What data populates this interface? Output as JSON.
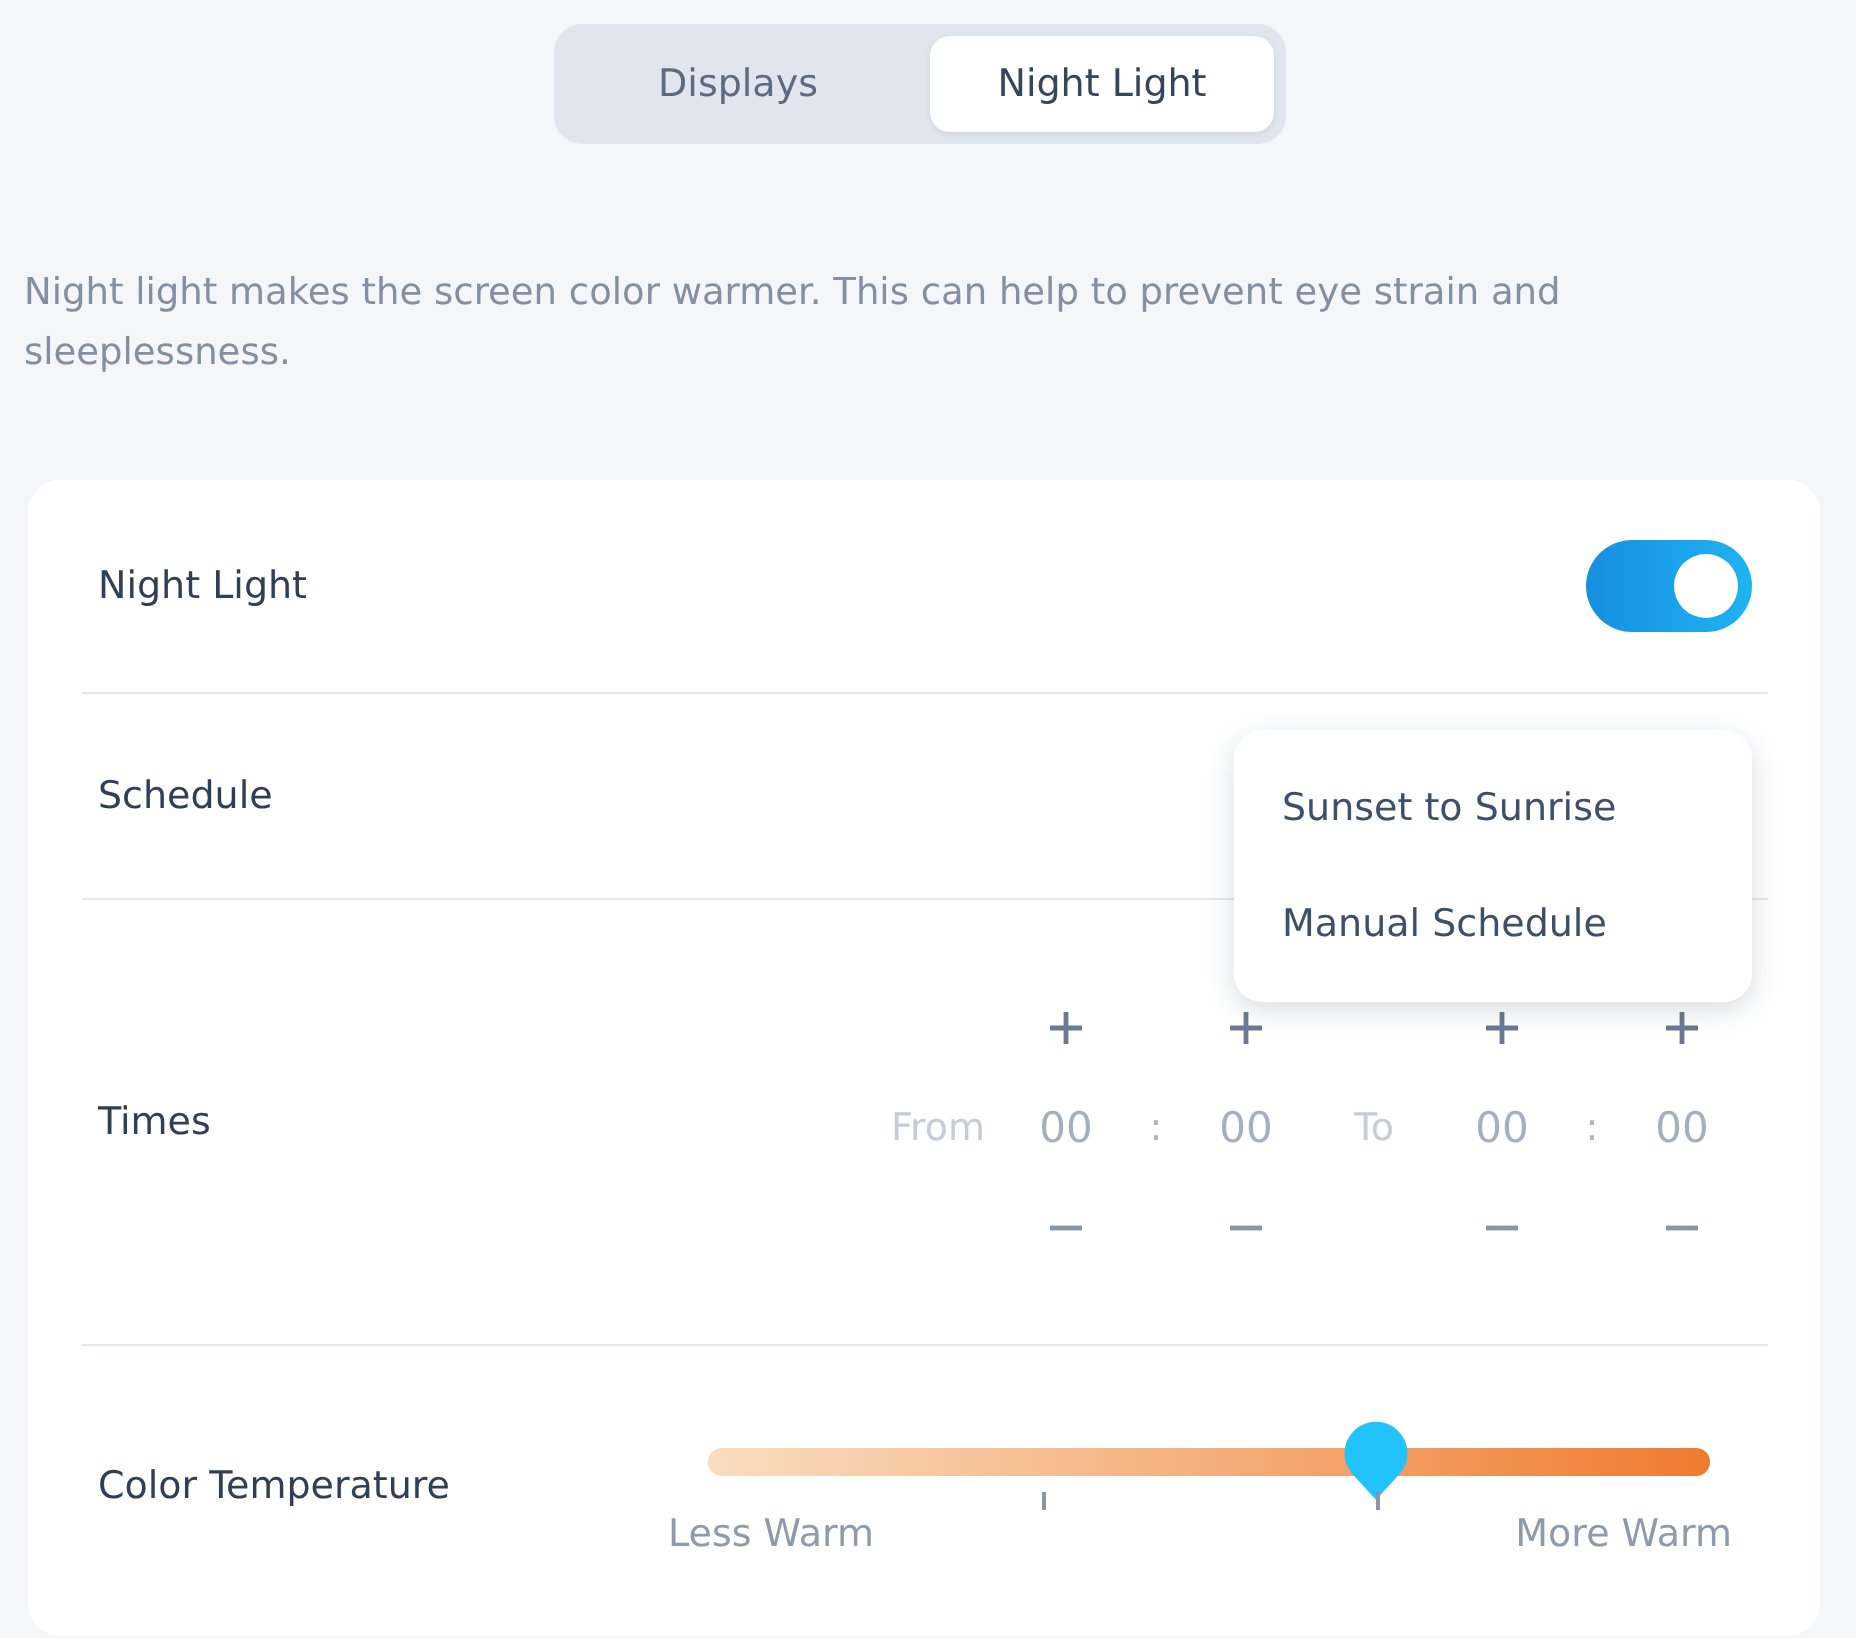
{
  "tabs": [
    {
      "label": "Displays",
      "selected": false
    },
    {
      "label": "Night Light",
      "selected": true
    }
  ],
  "description": "Night light makes the screen color warmer. This can help to prevent eye strain and sleeplessness.",
  "night_light": {
    "label": "Night Light",
    "on": true
  },
  "schedule": {
    "label": "Schedule",
    "menu": [
      {
        "label": "Sunset to Sunrise"
      },
      {
        "label": "Manual Schedule"
      }
    ]
  },
  "times": {
    "label": "Times",
    "from": {
      "label": "From",
      "hours": "00",
      "separator": ":",
      "minutes": "00"
    },
    "to": {
      "label": "To",
      "hours": "00",
      "separator": ":",
      "minutes": "00"
    }
  },
  "color_temperature": {
    "label": "Color Temperature",
    "level": 0.666,
    "min_label": "Less Warm",
    "max_label": "More Warm"
  }
}
